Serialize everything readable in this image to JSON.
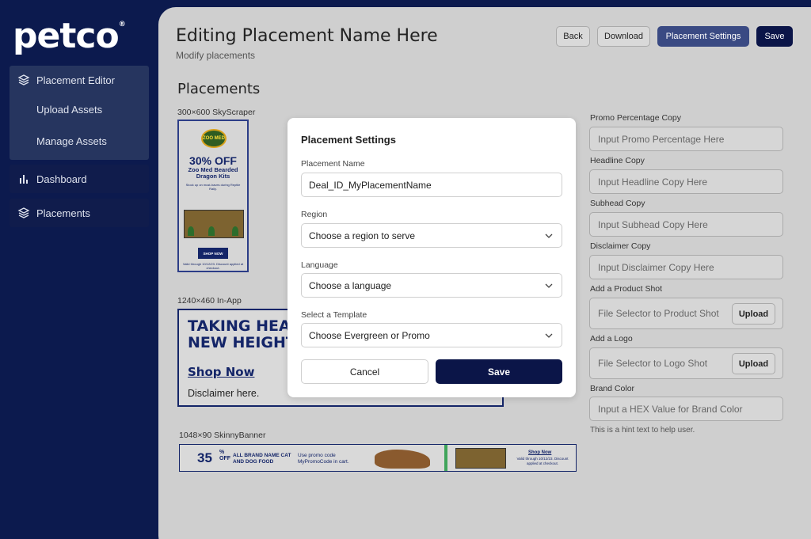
{
  "brand": {
    "logo": "petco"
  },
  "sidebar": {
    "items": [
      {
        "label": "Placement Editor",
        "icon": "layers-icon"
      },
      {
        "label": "Upload Assets"
      },
      {
        "label": "Manage Assets"
      },
      {
        "label": "Dashboard",
        "icon": "bar-chart-icon"
      },
      {
        "label": "Placements",
        "icon": "layers-icon"
      }
    ]
  },
  "header": {
    "title": "Editing Placement Name Here",
    "subtitle": "Modify placements",
    "buttons": {
      "back": "Back",
      "download": "Download",
      "settings": "Placement Settings",
      "save": "Save"
    }
  },
  "placements": {
    "title": "Placements",
    "skyscraper": {
      "label": "300×600 SkyScraper",
      "badge": "ZOO MED",
      "offer": "30% OFF",
      "product": "Zoo Med Bearded Dragon Kits",
      "desc": "Stock up on must-haves during Reptile Rally.",
      "cta": "SHOP NOW",
      "fine": "Valid through 10/12/23. Discount applied at checkout."
    },
    "inapp": {
      "label": "1240×460 In-App",
      "headline": "TAKING HEA\nNEW HEIGHT",
      "cta": "Shop Now",
      "disclaimer": "Disclaimer here."
    },
    "skinny": {
      "label": "1048×90 SkinnyBanner",
      "pct": "35",
      "pct_sym": "%",
      "off": "OFF",
      "brand": "ALL BRAND NAME CAT AND DOG FOOD",
      "promo": "Use promo code MyPromoCode in cart.",
      "cta": "Shop Now",
      "valid": "Valid through 10/12/23. Discount applied at checkout."
    }
  },
  "form": {
    "promo_pct": {
      "label": "Promo Percentage Copy",
      "placeholder": "Input Promo Percentage Here"
    },
    "headline": {
      "label": "Headline Copy",
      "placeholder": "Input Headline Copy Here"
    },
    "subhead": {
      "label": "Subhead Copy",
      "placeholder": "Input Subhead Copy Here"
    },
    "disclaimer": {
      "label": "Disclaimer Copy",
      "placeholder": "Input Disclaimer Copy Here"
    },
    "product_shot": {
      "label": "Add a Product Shot",
      "placeholder": "File Selector to Product Shot",
      "button": "Upload"
    },
    "logo": {
      "label": "Add a Logo",
      "placeholder": "File Selector to Logo Shot",
      "button": "Upload"
    },
    "brand_color": {
      "label": "Brand Color",
      "placeholder": "Input a HEX Value for Brand Color",
      "hint": "This is a hint text to help user."
    }
  },
  "modal": {
    "title": "Placement Settings",
    "name_label": "Placement Name",
    "name_value": "Deal_ID_MyPlacementName",
    "region_label": "Region",
    "region_value": "Choose a region to serve",
    "language_label": "Language",
    "language_value": "Choose a language",
    "template_label": "Select a Template",
    "template_value": "Choose Evergreen or Promo",
    "cancel": "Cancel",
    "save": "Save"
  },
  "colors": {
    "navy": "#0b1548",
    "sidebar_bg": "#0c1a4e",
    "accent": "#3a4a83"
  }
}
